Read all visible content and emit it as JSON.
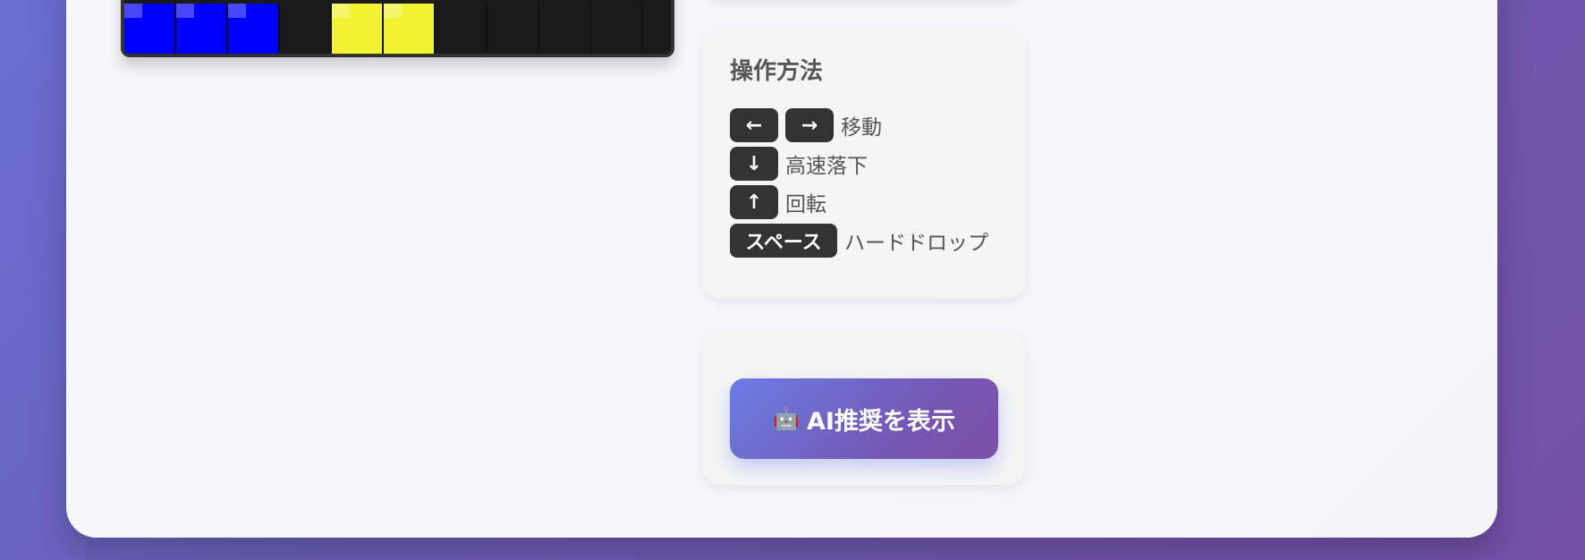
{
  "board": {
    "bottom_row": [
      {
        "color": "blue"
      },
      {
        "color": "blue"
      },
      {
        "color": "blue"
      },
      {
        "color": "empty"
      },
      {
        "color": "yellow"
      },
      {
        "color": "yellow"
      },
      {
        "color": "empty"
      },
      {
        "color": "empty"
      },
      {
        "color": "empty"
      },
      {
        "color": "empty"
      }
    ],
    "colors": {
      "blue": "#0000ff",
      "yellow": "#f2f233",
      "empty": "#1a1a1a"
    }
  },
  "controls": {
    "title": "操作方法",
    "rows": [
      {
        "keys": [
          "←",
          "→"
        ],
        "label": "移動"
      },
      {
        "keys": [
          "↓"
        ],
        "label": "高速落下"
      },
      {
        "keys": [
          "↑"
        ],
        "label": "回転"
      },
      {
        "keys": [
          "スペース"
        ],
        "label": "ハードドロップ"
      }
    ]
  },
  "ai_button": {
    "icon": "🤖",
    "icon_name": "robot-icon",
    "label": "AI推奨を表示"
  }
}
